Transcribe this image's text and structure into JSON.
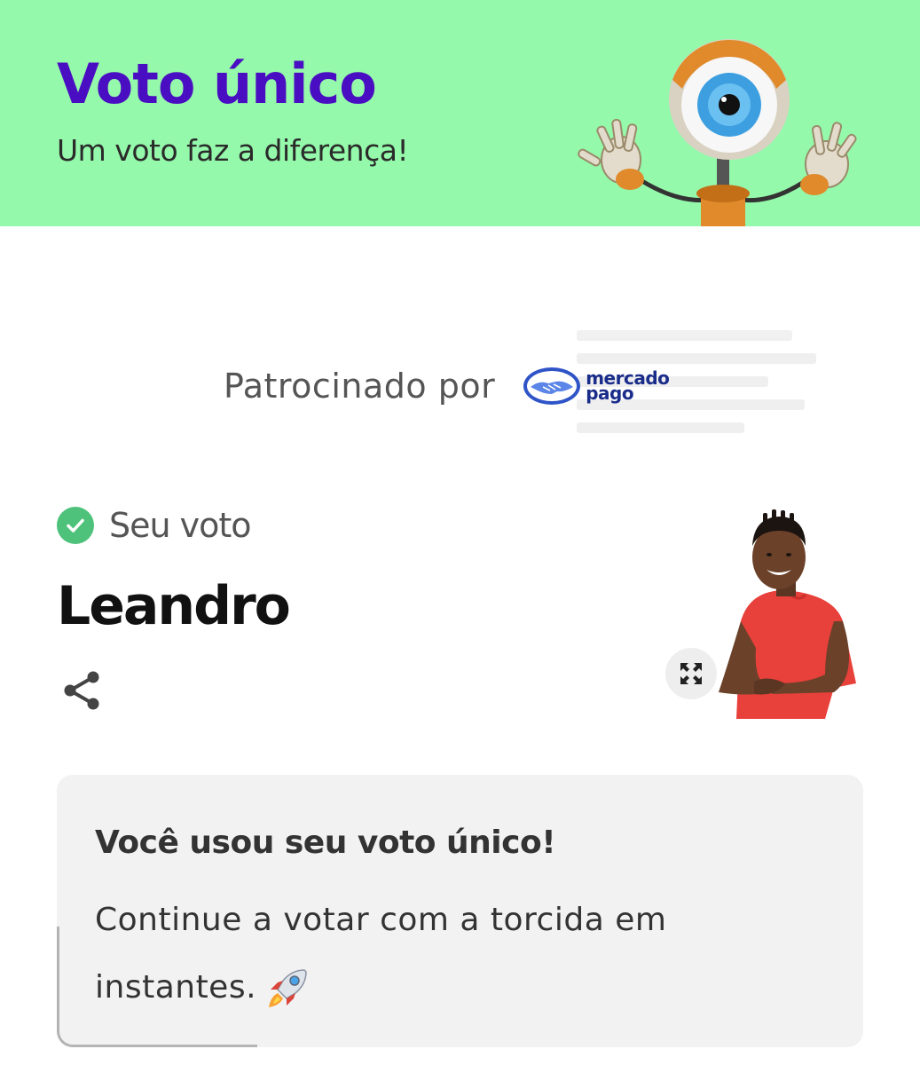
{
  "header": {
    "title": "Voto único",
    "subtitle": "Um voto faz a diferença!",
    "background_color": "#95f9ab",
    "title_color": "#4a0ec2",
    "mascot_icon": "big-brother-eye-mascot"
  },
  "sponsor": {
    "label": "Patrocinado por",
    "logo_line1": "mercado",
    "logo_line2": "pago",
    "logo_icon": "handshake-logo-icon"
  },
  "vote": {
    "status_icon": "check-circle-icon",
    "status_label": "Seu voto",
    "candidate_name": "Leandro",
    "share_icon": "share-icon",
    "expand_icon": "expand-icon"
  },
  "info_card": {
    "title": "Você usou seu voto único!",
    "body": "Continue a votar com a torcida em instantes.",
    "emoji_icon": "rocket-icon"
  }
}
